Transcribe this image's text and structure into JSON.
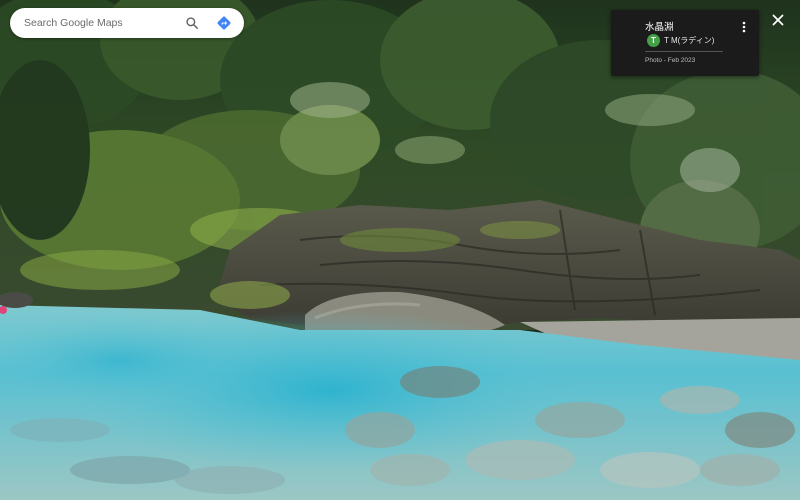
{
  "search": {
    "placeholder": "Search Google Maps",
    "value": ""
  },
  "info_card": {
    "title": "水晶淵",
    "author_initial": "T",
    "author_name": "T M(ラディン)",
    "photo_date": "Photo - Feb 2023"
  },
  "colors": {
    "directions_blue": "#4285f4",
    "avatar_green": "#43a047",
    "card_bg": "#1b1b1b"
  },
  "icons": {
    "search": "search-icon",
    "directions": "directions-icon",
    "more": "more-vert-icon",
    "close": "close-icon"
  }
}
